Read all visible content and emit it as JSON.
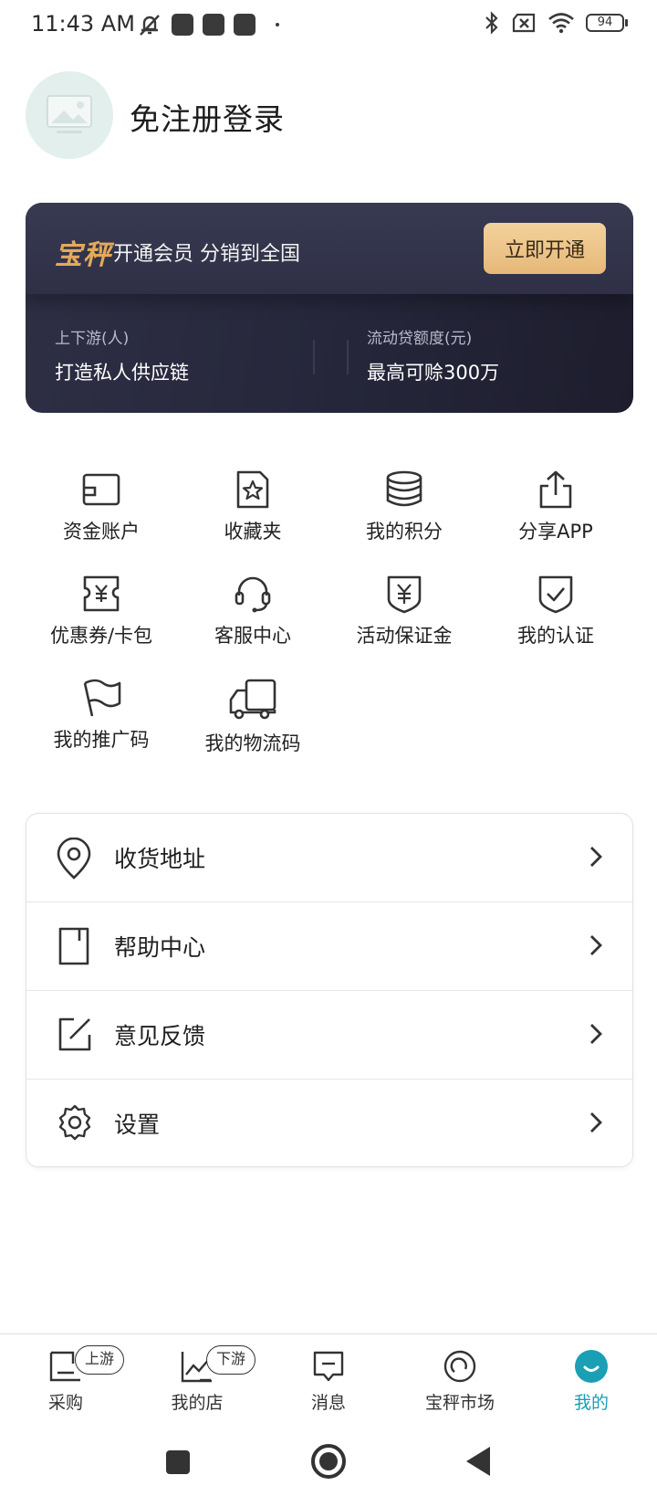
{
  "status_bar": {
    "time": "11:43 AM",
    "battery": "94"
  },
  "profile": {
    "login_text": "免注册登录"
  },
  "vip": {
    "brand": "宝秤",
    "slogan": "开通会员 分销到全国",
    "button": "立即开通",
    "stat1_label": "上下游(人)",
    "stat1_value": "打造私人供应链",
    "stat2_label": "流动贷额度(元)",
    "stat2_value": "最高可赊300万"
  },
  "grid": [
    {
      "label": "资金账户",
      "icon": "wallet-icon"
    },
    {
      "label": "收藏夹",
      "icon": "star-folder-icon"
    },
    {
      "label": "我的积分",
      "icon": "coins-icon"
    },
    {
      "label": "分享APP",
      "icon": "share-icon"
    },
    {
      "label": "优惠券/卡包",
      "icon": "coupon-icon"
    },
    {
      "label": "客服中心",
      "icon": "headset-icon"
    },
    {
      "label": "活动保证金",
      "icon": "shield-yen-icon"
    },
    {
      "label": "我的认证",
      "icon": "shield-check-icon"
    },
    {
      "label": "我的推广码",
      "icon": "flag-icon"
    },
    {
      "label": "我的物流码",
      "icon": "truck-icon"
    }
  ],
  "menu": [
    {
      "label": "收货地址",
      "icon": "location-icon"
    },
    {
      "label": "帮助中心",
      "icon": "help-book-icon"
    },
    {
      "label": "意见反馈",
      "icon": "edit-icon"
    },
    {
      "label": "设置",
      "icon": "gear-icon"
    }
  ],
  "bottom_nav": [
    {
      "label": "采购",
      "badge": "上游",
      "icon": "purchase-icon"
    },
    {
      "label": "我的店",
      "badge": "下游",
      "icon": "store-chart-icon"
    },
    {
      "label": "消息",
      "icon": "message-icon"
    },
    {
      "label": "宝秤市场",
      "icon": "market-icon"
    },
    {
      "label": "我的",
      "icon": "profile-face-icon",
      "active": true
    }
  ],
  "colors": {
    "accent": "#1a9fb5",
    "vip_gold": "#e4a95a",
    "vip_bg": "#2a2b40"
  }
}
